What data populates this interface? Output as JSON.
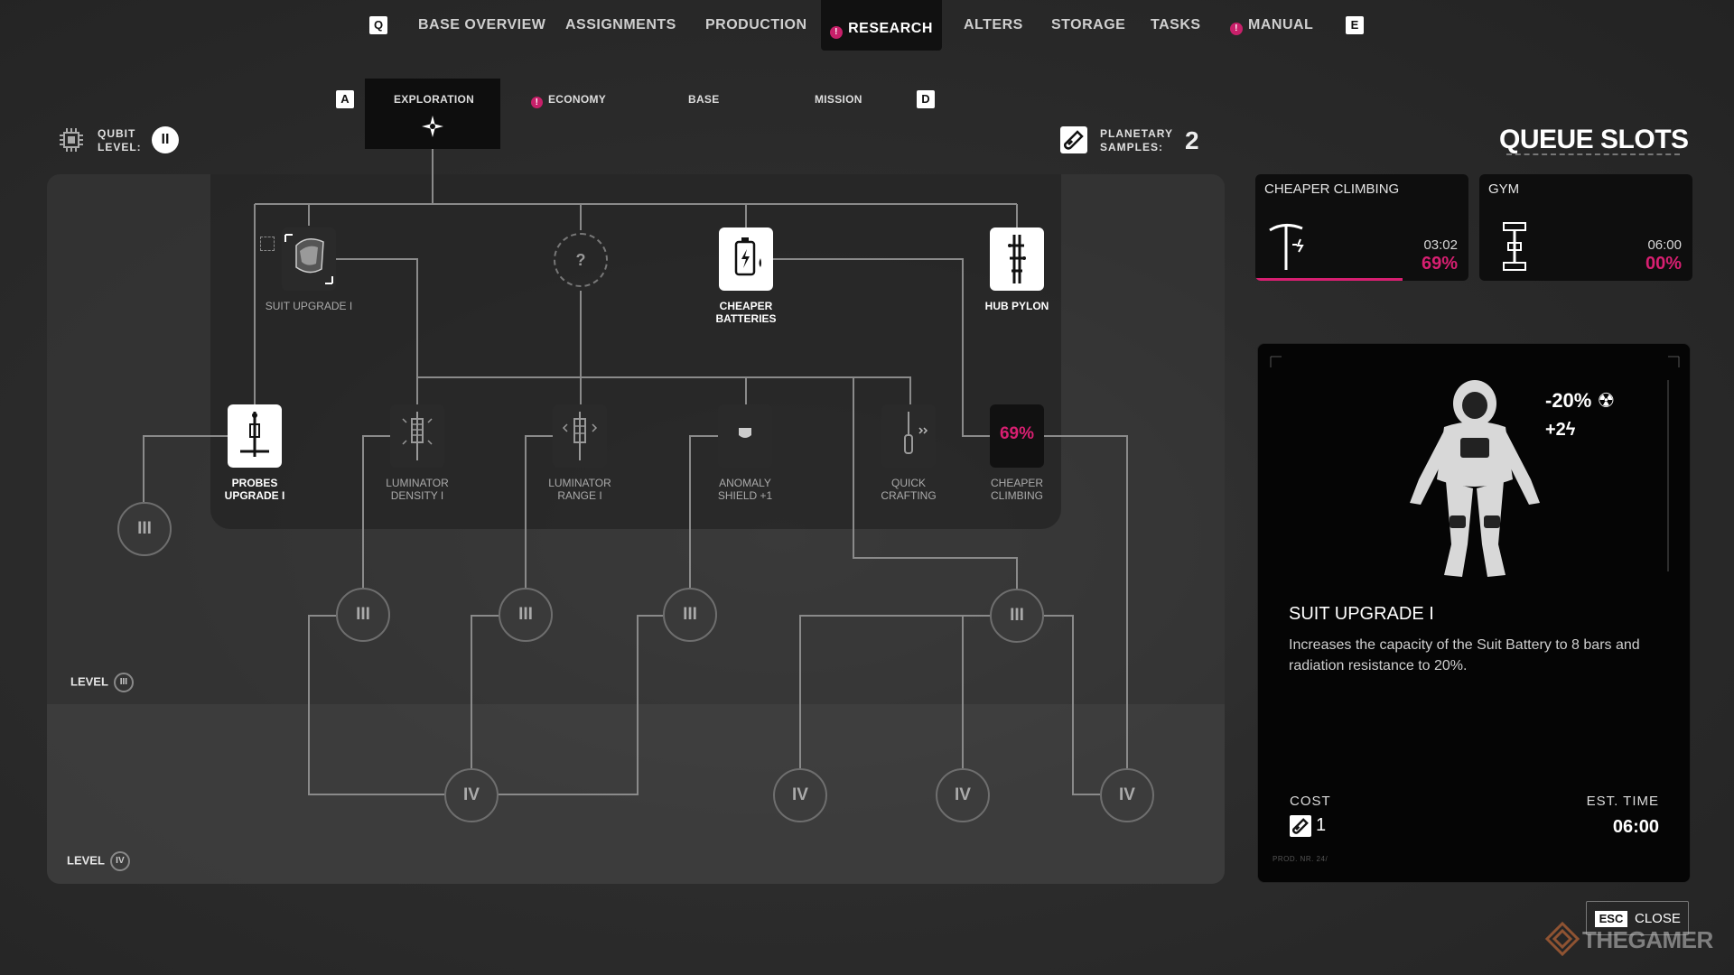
{
  "topnav": {
    "key_left": "Q",
    "key_right": "E",
    "tabs": [
      {
        "label": "BASE OVERVIEW"
      },
      {
        "label": "ASSIGNMENTS"
      },
      {
        "label": "PRODUCTION"
      },
      {
        "label": "RESEARCH",
        "active": true,
        "alert": true
      },
      {
        "label": "ALTERS"
      },
      {
        "label": "STORAGE"
      },
      {
        "label": "TASKS"
      },
      {
        "label": "MANUAL",
        "alert": true
      }
    ]
  },
  "subnav": {
    "key_left": "A",
    "key_right": "D",
    "tabs": [
      {
        "label": "EXPLORATION",
        "active": true
      },
      {
        "label": "ECONOMY",
        "alert": true
      },
      {
        "label": "BASE"
      },
      {
        "label": "MISSION"
      }
    ]
  },
  "qubit": {
    "label_line1": "QUBIT",
    "label_line2": "LEVEL:",
    "value": "II"
  },
  "samples": {
    "label_line1": "PLANETARY",
    "label_line2": "SAMPLES:",
    "value": "2"
  },
  "tree": {
    "nodes": [
      {
        "id": "suit-upgrade",
        "label": "SUIT UPGRADE I",
        "state": "selected"
      },
      {
        "id": "unknown",
        "label": "?",
        "state": "locked"
      },
      {
        "id": "cheaper-batteries",
        "label": "CHEAPER\nBATTERIES",
        "state": "unlocked"
      },
      {
        "id": "hub-pylon",
        "label": "HUB PYLON",
        "state": "unlocked"
      },
      {
        "id": "probes-upgrade",
        "label": "PROBES\nUPGRADE I",
        "state": "unlocked"
      },
      {
        "id": "luminator-density",
        "label": "LUMINATOR\nDENSITY I",
        "state": "available"
      },
      {
        "id": "luminator-range",
        "label": "LUMINATOR\nRANGE I",
        "state": "available"
      },
      {
        "id": "anomaly-shield",
        "label": "ANOMALY\nSHIELD +1",
        "state": "available"
      },
      {
        "id": "quick-crafting",
        "label": "QUICK\nCRAFTING",
        "state": "available"
      },
      {
        "id": "cheaper-climbing",
        "label": "CHEAPER\nCLIMBING",
        "state": "researching",
        "progress": "69%"
      }
    ],
    "level_nodes": [
      "III",
      "III",
      "III",
      "III",
      "III",
      "IV",
      "IV",
      "IV",
      "IV"
    ],
    "levels": [
      {
        "label": "LEVEL",
        "numeral": "III"
      },
      {
        "label": "LEVEL",
        "numeral": "IV"
      }
    ]
  },
  "queue": {
    "title": "QUEUE SLOTS",
    "slots": [
      {
        "name": "CHEAPER CLIMBING",
        "time": "03:02",
        "progress": "69%",
        "progress_value": 0.69,
        "icon": "pickaxe-icon"
      },
      {
        "name": "GYM",
        "time": "06:00",
        "progress": "00%",
        "progress_value": 0.0,
        "icon": "dumbbell-icon"
      }
    ]
  },
  "detail": {
    "title": "SUIT UPGRADE I",
    "description": "Increases the capacity of the Suit Battery to 8 bars and radiation resistance to 20%.",
    "stat1": "-20% ☢",
    "stat2": "+2ϟ",
    "cost_label": "COST",
    "cost_value": "1",
    "est_label": "EST. TIME",
    "est_value": "06:00",
    "prod_footer": "PROD. NR. 24/"
  },
  "close": {
    "key": "ESC",
    "label": "CLOSE"
  },
  "watermark": "THEGAMER",
  "colors": {
    "accent": "#d81f71",
    "panel": "#0e0e0e"
  }
}
